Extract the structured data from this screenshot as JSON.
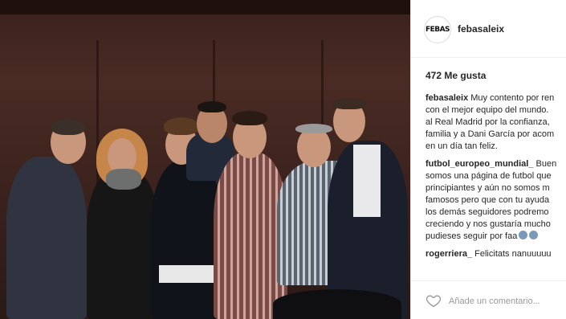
{
  "post": {
    "username": "febasaleix",
    "avatar_text": "FEBAS",
    "likes": "472 Me gusta",
    "comments": [
      {
        "user": "febasaleix",
        "lines": [
          "Muy contento por ren",
          "con el mejor equipo del mundo.",
          "al Real Madrid por la confianza,",
          "familia y a Dani García por acom",
          "en un día tan feliz."
        ]
      },
      {
        "user": "futbol_europeo_mundial_",
        "lines": [
          "Buen",
          "somos una página de futbol que",
          "principiantes y aún no somos m",
          "famosos pero que con tu ayuda",
          "los demás seguidores podremo",
          "creciendo y nos gustaría mucho",
          "pudieses seguir por faa"
        ]
      },
      {
        "user": "rogerriera_",
        "lines": [
          "Felicitats nanuuuuu"
        ]
      }
    ],
    "add_comment_placeholder": "Añade un comentario...",
    "icons": {
      "like": "heart-icon"
    },
    "colors": {
      "border": "#efefef",
      "text": "#262626",
      "placeholder": "#999999"
    }
  }
}
